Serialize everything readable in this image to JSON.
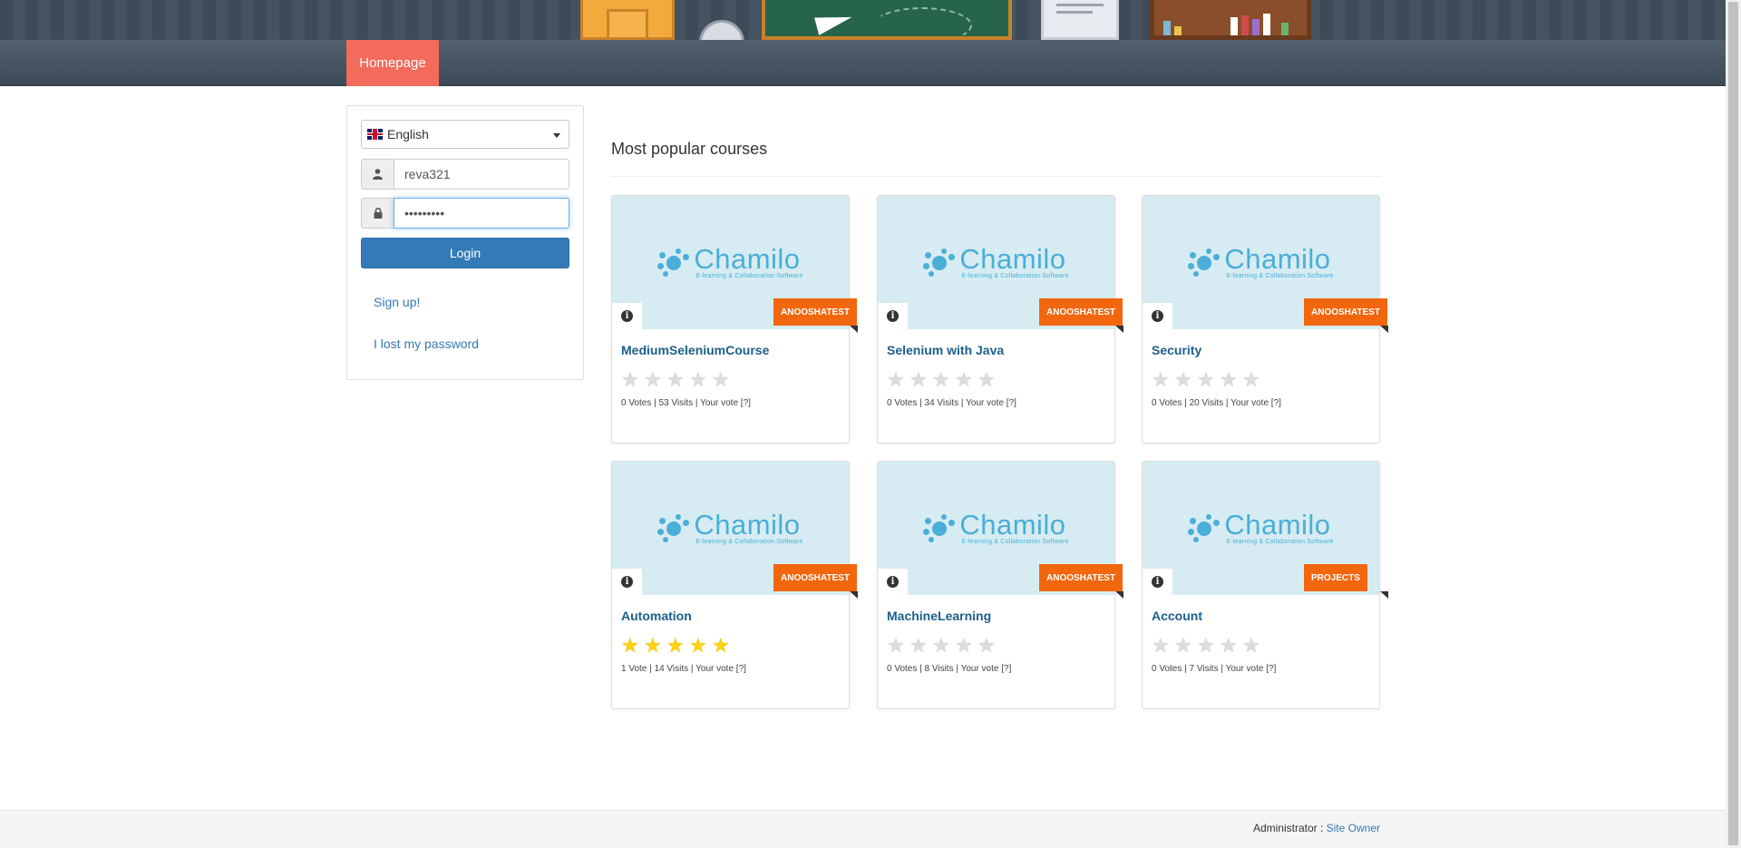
{
  "nav": {
    "home_label": "Homepage"
  },
  "login": {
    "language_selected": "English",
    "username_value": "reva321",
    "password_value": "•••••••••",
    "login_label": "Login",
    "signup_label": "Sign up!",
    "lost_password_label": "I lost my password"
  },
  "main": {
    "section_title": "Most popular courses",
    "courses": [
      {
        "title": "MediumSeleniumCourse",
        "category": "ANOOSHATEST",
        "rating": 0,
        "vote_count": "0 Votes",
        "visits": "53 Visits"
      },
      {
        "title": "Selenium with Java",
        "category": "ANOOSHATEST",
        "rating": 0,
        "vote_count": "0 Votes",
        "visits": "34 Visits"
      },
      {
        "title": "Security",
        "category": "ANOOSHATEST",
        "rating": 0,
        "vote_count": "0 Votes",
        "visits": "20 Visits"
      },
      {
        "title": "Automation",
        "category": "ANOOSHATEST",
        "rating": 5,
        "vote_count": "1 Vote",
        "visits": "14 Visits"
      },
      {
        "title": "MachineLearning",
        "category": "ANOOSHATEST",
        "rating": 0,
        "vote_count": "0 Votes",
        "visits": "8 Visits"
      },
      {
        "title": "Account",
        "category": "PROJECTS",
        "rating": 0,
        "vote_count": "0 Votes",
        "visits": "7 Visits"
      }
    ],
    "your_vote_label": "Your vote",
    "help_label": "[?]",
    "logo_word": "Chamilo",
    "logo_sub": "E-learning & Collaboration Software"
  },
  "footer": {
    "admin_label": "Administrator :",
    "admin_name": "Site Owner"
  },
  "colors": {
    "accent": "#f26b5b",
    "tag": "#f2660d",
    "primary": "#337ab7",
    "title_link": "#1c5f8c",
    "star_on": "#ffd10f"
  },
  "icons": {
    "user": "user-icon",
    "lock": "lock-icon",
    "info": "info-icon",
    "flag": "uk-flag-icon"
  }
}
